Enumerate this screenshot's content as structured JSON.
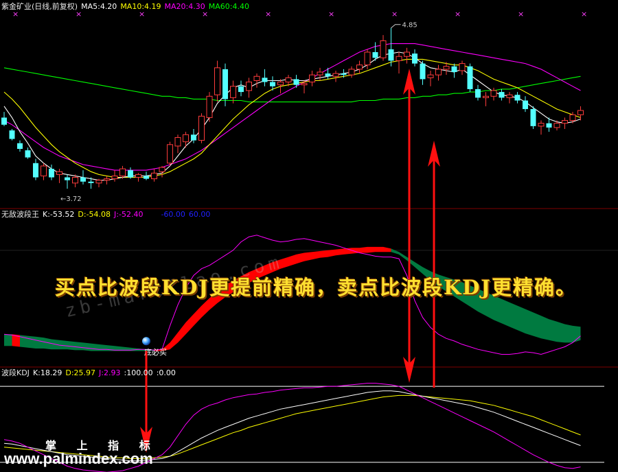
{
  "colors": {
    "up": "#ff3c3c",
    "down": "#54ffff",
    "ma5": "#ffffff",
    "ma10": "#ffff00",
    "ma20": "#ff00ff",
    "ma60": "#00ff00",
    "bandUp": "#ff0000",
    "bandDown": "#007a40",
    "divider": "#800000",
    "arrow": "#ff1010"
  },
  "panel1": {
    "title": "紫金矿业(日线,前复权)",
    "indicators": [
      {
        "label": "MA5:4.20",
        "color": "#ffffff"
      },
      {
        "label": "MA10:4.19",
        "color": "#ffff00"
      },
      {
        "label": "MA20:4.30",
        "color": "#ff00ff"
      },
      {
        "label": "MA60:4.40",
        "color": "#00ff00"
      }
    ],
    "high_label": "4.85",
    "low_label": "←3.72"
  },
  "panel2": {
    "title": "无敌波段王",
    "indicators": [
      {
        "label": "K:-53.52",
        "color": "#ffffff"
      },
      {
        "label": "D:-54.08",
        "color": "#ffff00"
      },
      {
        "label": "J:-52.40",
        "color": "#ff00ff"
      },
      {
        "label": "-60.00",
        "color": "#0000ff"
      },
      {
        "label": "60.00",
        "color": "#0000ff"
      }
    ],
    "buy_label": "底必买"
  },
  "panel3": {
    "title": "波段KDJ",
    "indicators": [
      {
        "label": "K:18.29",
        "color": "#ffffff"
      },
      {
        "label": "D:25.97",
        "color": "#ffff00"
      },
      {
        "label": "J:2.93",
        "color": "#ff00ff"
      },
      {
        "label": ":100.00",
        "color": "#ffffff"
      },
      {
        "label": ":0.00",
        "color": "#ffffff"
      }
    ]
  },
  "banner": "买点比波段KDJ更提前精确，卖点比波段KDJ更精确。",
  "watermark": "zb-martflao.com",
  "brand": "掌 上 指 标",
  "site": "www.palmindex.com",
  "chart_data": [
    {
      "type": "candlestick",
      "title": "紫金矿业(日线,前复权)",
      "ylim": [
        3.6,
        4.95
      ],
      "candles": [
        [
          4.22,
          4.26,
          4.16,
          4.17
        ],
        [
          4.13,
          4.14,
          4.06,
          4.07
        ],
        [
          4.04,
          4.06,
          3.98,
          4.0
        ],
        [
          3.99,
          4.01,
          3.93,
          3.94
        ],
        [
          3.9,
          3.93,
          3.78,
          3.8
        ],
        [
          3.81,
          3.9,
          3.78,
          3.88
        ],
        [
          3.86,
          3.89,
          3.78,
          3.8
        ],
        [
          3.82,
          3.86,
          3.76,
          3.84
        ],
        [
          3.8,
          3.82,
          3.72,
          3.78
        ],
        [
          3.76,
          3.82,
          3.73,
          3.8
        ],
        [
          3.8,
          3.85,
          3.75,
          3.77
        ],
        [
          3.77,
          3.8,
          3.72,
          3.76
        ],
        [
          3.76,
          3.79,
          3.73,
          3.78
        ],
        [
          3.78,
          3.81,
          3.75,
          3.79
        ],
        [
          3.79,
          3.85,
          3.77,
          3.81
        ],
        [
          3.81,
          3.88,
          3.79,
          3.86
        ],
        [
          3.85,
          3.87,
          3.79,
          3.8
        ],
        [
          3.8,
          3.83,
          3.77,
          3.82
        ],
        [
          3.81,
          3.84,
          3.78,
          3.79
        ],
        [
          3.79,
          3.86,
          3.77,
          3.83
        ],
        [
          3.84,
          3.88,
          3.8,
          3.87
        ],
        [
          3.9,
          4.05,
          3.88,
          4.03
        ],
        [
          4.02,
          4.1,
          3.97,
          4.08
        ],
        [
          4.05,
          4.12,
          4.01,
          4.1
        ],
        [
          4.1,
          4.14,
          4.04,
          4.06
        ],
        [
          4.06,
          4.25,
          4.04,
          4.23
        ],
        [
          4.22,
          4.4,
          4.19,
          4.37
        ],
        [
          4.38,
          4.62,
          4.33,
          4.57
        ],
        [
          4.56,
          4.6,
          4.3,
          4.35
        ],
        [
          4.36,
          4.48,
          4.32,
          4.44
        ],
        [
          4.44,
          4.48,
          4.37,
          4.4
        ],
        [
          4.41,
          4.5,
          4.36,
          4.47
        ],
        [
          4.48,
          4.53,
          4.43,
          4.51
        ],
        [
          4.5,
          4.56,
          4.44,
          4.47
        ],
        [
          4.47,
          4.51,
          4.41,
          4.44
        ],
        [
          4.45,
          4.49,
          4.39,
          4.47
        ],
        [
          4.47,
          4.52,
          4.44,
          4.5
        ],
        [
          4.49,
          4.52,
          4.43,
          4.45
        ],
        [
          4.45,
          4.48,
          4.39,
          4.46
        ],
        [
          4.47,
          4.55,
          4.44,
          4.52
        ],
        [
          4.52,
          4.57,
          4.48,
          4.54
        ],
        [
          4.53,
          4.57,
          4.49,
          4.51
        ],
        [
          4.51,
          4.55,
          4.47,
          4.53
        ],
        [
          4.53,
          4.56,
          4.5,
          4.52
        ],
        [
          4.52,
          4.58,
          4.5,
          4.56
        ],
        [
          4.56,
          4.62,
          4.53,
          4.59
        ],
        [
          4.59,
          4.7,
          4.56,
          4.68
        ],
        [
          4.68,
          4.75,
          4.62,
          4.64
        ],
        [
          4.64,
          4.8,
          4.62,
          4.76
        ],
        [
          4.7,
          4.85,
          4.58,
          4.62
        ],
        [
          4.62,
          4.68,
          4.53,
          4.65
        ],
        [
          4.65,
          4.71,
          4.6,
          4.68
        ],
        [
          4.67,
          4.7,
          4.58,
          4.6
        ],
        [
          4.6,
          4.62,
          4.45,
          4.49
        ],
        [
          4.5,
          4.55,
          4.44,
          4.52
        ],
        [
          4.52,
          4.59,
          4.48,
          4.56
        ],
        [
          4.56,
          4.61,
          4.52,
          4.58
        ],
        [
          4.58,
          4.6,
          4.5,
          4.54
        ],
        [
          4.55,
          4.62,
          4.52,
          4.6
        ],
        [
          4.58,
          4.6,
          4.4,
          4.42
        ],
        [
          4.42,
          4.45,
          4.34,
          4.36
        ],
        [
          4.36,
          4.4,
          4.3,
          4.37
        ],
        [
          4.37,
          4.43,
          4.34,
          4.41
        ],
        [
          4.4,
          4.42,
          4.34,
          4.36
        ],
        [
          4.36,
          4.4,
          4.32,
          4.38
        ],
        [
          4.38,
          4.4,
          4.32,
          4.34
        ],
        [
          4.34,
          4.37,
          4.26,
          4.28
        ],
        [
          4.28,
          4.3,
          4.14,
          4.16
        ],
        [
          4.16,
          4.2,
          4.1,
          4.18
        ],
        [
          4.18,
          4.22,
          4.12,
          4.15
        ],
        [
          4.15,
          4.2,
          4.13,
          4.18
        ],
        [
          4.18,
          4.22,
          4.14,
          4.2
        ],
        [
          4.2,
          4.26,
          4.18,
          4.24
        ],
        [
          4.24,
          4.3,
          4.2,
          4.27
        ]
      ],
      "ma5": [
        4.3,
        4.22,
        4.12,
        4.04,
        3.95,
        3.9,
        3.86,
        3.83,
        3.82,
        3.81,
        3.8,
        3.79,
        3.78,
        3.78,
        3.79,
        3.8,
        3.81,
        3.81,
        3.81,
        3.82,
        3.83,
        3.88,
        3.95,
        4.02,
        4.07,
        4.14,
        4.22,
        4.32,
        4.38,
        4.43,
        4.45,
        4.43,
        4.46,
        4.48,
        4.48,
        4.48,
        4.49,
        4.48,
        4.48,
        4.49,
        4.5,
        4.51,
        4.52,
        4.53,
        4.54,
        4.56,
        4.59,
        4.63,
        4.66,
        4.67,
        4.68,
        4.67,
        4.64,
        4.6,
        4.57,
        4.56,
        4.55,
        4.54,
        4.56,
        4.52,
        4.48,
        4.44,
        4.4,
        4.38,
        4.37,
        4.36,
        4.33,
        4.29,
        4.25,
        4.21,
        4.19,
        4.18,
        4.19,
        4.21
      ],
      "ma10": [
        4.4,
        4.35,
        4.29,
        4.22,
        4.15,
        4.09,
        4.03,
        3.98,
        3.94,
        3.9,
        3.87,
        3.84,
        3.82,
        3.81,
        3.8,
        3.8,
        3.8,
        3.8,
        3.8,
        3.81,
        3.82,
        3.84,
        3.87,
        3.9,
        3.93,
        3.97,
        4.03,
        4.09,
        4.15,
        4.21,
        4.26,
        4.31,
        4.35,
        4.39,
        4.42,
        4.44,
        4.45,
        4.46,
        4.47,
        4.48,
        4.48,
        4.49,
        4.5,
        4.51,
        4.52,
        4.53,
        4.55,
        4.57,
        4.59,
        4.61,
        4.62,
        4.63,
        4.63,
        4.63,
        4.62,
        4.61,
        4.6,
        4.59,
        4.59,
        4.57,
        4.55,
        4.52,
        4.49,
        4.47,
        4.45,
        4.43,
        4.4,
        4.37,
        4.34,
        4.31,
        4.28,
        4.26,
        4.24,
        4.22
      ],
      "ma20": [
        4.2,
        4.17,
        4.13,
        4.09,
        4.05,
        4.01,
        3.98,
        3.95,
        3.93,
        3.91,
        3.89,
        3.88,
        3.87,
        3.86,
        3.85,
        3.85,
        3.85,
        3.85,
        3.85,
        3.86,
        3.87,
        3.89,
        3.91,
        3.93,
        3.96,
        3.99,
        4.03,
        4.07,
        4.11,
        4.15,
        4.19,
        4.23,
        4.27,
        4.31,
        4.35,
        4.38,
        4.41,
        4.44,
        4.47,
        4.5,
        4.53,
        4.56,
        4.59,
        4.62,
        4.65,
        4.68,
        4.7,
        4.72,
        4.73,
        4.74,
        4.74,
        4.74,
        4.74,
        4.73,
        4.72,
        4.71,
        4.7,
        4.69,
        4.68,
        4.67,
        4.66,
        4.65,
        4.64,
        4.63,
        4.62,
        4.61,
        4.6,
        4.58,
        4.56,
        4.53,
        4.5,
        4.47,
        4.44,
        4.41
      ],
      "ma60": [
        4.57,
        4.56,
        4.55,
        4.54,
        4.53,
        4.52,
        4.51,
        4.5,
        4.49,
        4.48,
        4.47,
        4.46,
        4.45,
        4.44,
        4.43,
        4.42,
        4.41,
        4.4,
        4.39,
        4.38,
        4.37,
        4.37,
        4.36,
        4.36,
        4.35,
        4.35,
        4.35,
        4.34,
        4.34,
        4.34,
        4.34,
        4.33,
        4.33,
        4.33,
        4.33,
        4.33,
        4.33,
        4.33,
        4.33,
        4.33,
        4.33,
        4.33,
        4.33,
        4.33,
        4.33,
        4.34,
        4.34,
        4.34,
        4.35,
        4.35,
        4.35,
        4.36,
        4.36,
        4.37,
        4.37,
        4.38,
        4.38,
        4.39,
        4.39,
        4.4,
        4.4,
        4.41,
        4.41,
        4.42,
        4.42,
        4.43,
        4.44,
        4.45,
        4.46,
        4.47,
        4.48,
        4.49,
        4.5,
        4.51
      ]
    },
    {
      "type": "area",
      "title": "无敌波段王",
      "ylim": [
        -75,
        95
      ],
      "upper": [
        -40,
        -40,
        -41,
        -42,
        -43,
        -44,
        -46,
        -47,
        -48,
        -49,
        -50,
        -51,
        -52,
        -53,
        -54,
        -55,
        -56,
        -57,
        -58,
        -58,
        -58,
        -50,
        -38,
        -26,
        -16,
        -6,
        3,
        11,
        18,
        24,
        29,
        34,
        38,
        42,
        46,
        49,
        52,
        55,
        57,
        58,
        59,
        60,
        61,
        62,
        63,
        63,
        64,
        64,
        64,
        62,
        58,
        52,
        46,
        40,
        35,
        31,
        28,
        25,
        22,
        18,
        14,
        10,
        6,
        2,
        -2,
        -6,
        -10,
        -14,
        -18,
        -22,
        -25,
        -28,
        -30,
        -31
      ],
      "lower": [
        -54,
        -54,
        -55,
        -56,
        -57,
        -57,
        -58,
        -58,
        -58,
        -59,
        -59,
        -60,
        -60,
        -60,
        -60,
        -60,
        -60,
        -60,
        -60,
        -60,
        -60,
        -58,
        -50,
        -40,
        -30,
        -20,
        -11,
        -3,
        4,
        10,
        16,
        21,
        26,
        30,
        34,
        38,
        41,
        44,
        47,
        49,
        51,
        52,
        54,
        55,
        56,
        57,
        57,
        58,
        58,
        58,
        55,
        48,
        40,
        32,
        24,
        17,
        11,
        5,
        -1,
        -7,
        -13,
        -18,
        -23,
        -27,
        -31,
        -35,
        -39,
        -42,
        -45,
        -47,
        -49,
        -50,
        -50,
        -47
      ],
      "j": [
        -40,
        -41,
        -43,
        -45,
        -47,
        -49,
        -51,
        -53,
        -54,
        -55,
        -56,
        -57,
        -58,
        -58,
        -59,
        -59,
        -59,
        -58,
        -58,
        -59,
        -58,
        -30,
        -5,
        15,
        30,
        38,
        42,
        48,
        54,
        60,
        70,
        76,
        78,
        75,
        72,
        70,
        71,
        73,
        74,
        72,
        70,
        68,
        66,
        63,
        60,
        57,
        55,
        53,
        52,
        52,
        50,
        30,
        0,
        -20,
        -32,
        -40,
        -45,
        -48,
        -52,
        -55,
        -58,
        -60,
        -62,
        -64,
        -64,
        -63,
        -61,
        -62,
        -64,
        -61,
        -58,
        -55,
        -50,
        -42
      ]
    },
    {
      "type": "line",
      "title": "波段KDJ",
      "ylim": [
        -10,
        110
      ],
      "hlines": [
        100,
        0
      ],
      "k": [
        25,
        24,
        22,
        20,
        18,
        16,
        14,
        12,
        10,
        9,
        8,
        7,
        6,
        5,
        4,
        3,
        2,
        2,
        3,
        4,
        5,
        8,
        14,
        20,
        26,
        32,
        37,
        42,
        46,
        50,
        54,
        58,
        61,
        64,
        67,
        70,
        72,
        74,
        76,
        78,
        80,
        82,
        84,
        86,
        88,
        90,
        92,
        93,
        94,
        94,
        93,
        91,
        89,
        87,
        85,
        83,
        81,
        79,
        77,
        75,
        72,
        69,
        66,
        62,
        58,
        54,
        50,
        46,
        42,
        38,
        34,
        30,
        26,
        22
      ],
      "d": [
        20,
        19,
        18,
        17,
        16,
        15,
        14,
        13,
        12,
        11,
        10,
        9,
        8,
        7,
        6,
        6,
        5,
        5,
        5,
        6,
        7,
        8,
        11,
        15,
        19,
        23,
        27,
        31,
        35,
        39,
        42,
        46,
        49,
        52,
        55,
        58,
        61,
        64,
        66,
        68,
        70,
        72,
        74,
        76,
        78,
        80,
        82,
        84,
        86,
        87,
        88,
        88,
        88,
        87,
        86,
        85,
        84,
        83,
        82,
        81,
        79,
        77,
        75,
        72,
        69,
        66,
        63,
        60,
        56,
        52,
        48,
        44,
        40,
        36
      ],
      "j": [
        30,
        28,
        25,
        20,
        15,
        10,
        5,
        0,
        -5,
        -8,
        -10,
        -11,
        -12,
        -13,
        -12,
        -11,
        -8,
        -5,
        0,
        5,
        10,
        20,
        35,
        50,
        62,
        70,
        75,
        78,
        82,
        85,
        87,
        89,
        90,
        92,
        93,
        95,
        96,
        97,
        98,
        98,
        99,
        100,
        100,
        101,
        102,
        103,
        104,
        104,
        103,
        102,
        100,
        95,
        90,
        85,
        80,
        75,
        70,
        65,
        60,
        55,
        50,
        45,
        40,
        34,
        28,
        22,
        16,
        10,
        5,
        0,
        -4,
        -7,
        -8,
        -6
      ]
    }
  ]
}
